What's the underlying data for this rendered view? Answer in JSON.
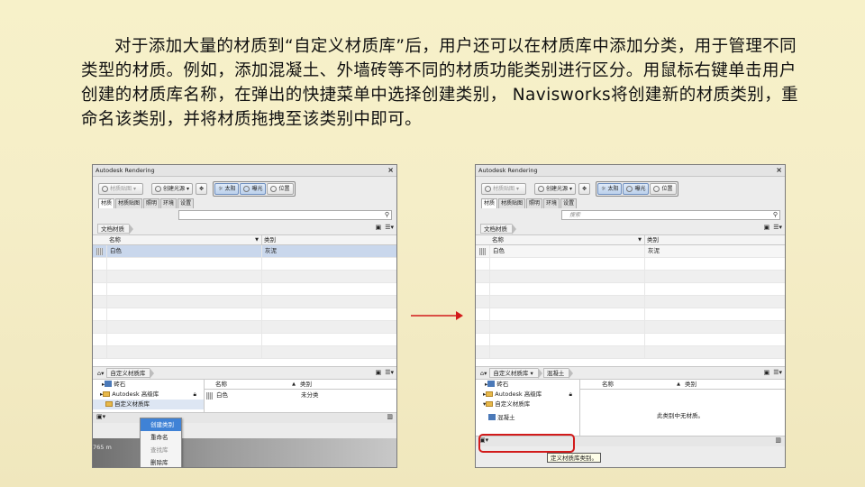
{
  "paragraph": "对于添加大量的材质到“自定义材质库”后，用户还可以在材质库中添加分类，用于管理不同类型的材质。例如，添加混凝土、外墙砖等不同的材质功能类别进行区分。用鼠标右键单击用户创建的材质库名称，在弹出的快捷菜单中选择创建类别， Navisworks将创建新的材质类别，重命名该类别，并将材质拖拽至该类别中即可。",
  "colors": {
    "arrow": "#d21b1b",
    "selection": "#c9d7ec",
    "menu_highlight": "#3f82d6"
  },
  "window1": {
    "title": "Autodesk Rendering",
    "toolbar": {
      "material_map": "材质贴图",
      "create_light": "创建光源",
      "sun": "太阳",
      "exposure": "曝光",
      "location": "位置"
    },
    "tabs": [
      "材质",
      "材质贴图",
      "照明",
      "环境",
      "设置"
    ],
    "crumb": "文档材质",
    "grid_header": {
      "name": "名称",
      "category": "类别"
    },
    "grid_rows": [
      {
        "name": "白色",
        "category": "灰泥"
      }
    ],
    "lib_crumb": "自定义材质库",
    "tree": [
      "砖石",
      "Autodesk 高级库",
      "自定义材质库"
    ],
    "lib_header": {
      "name": "名称",
      "category": "类别"
    },
    "lib_rows": [
      {
        "name": "白色",
        "category": "未分类"
      }
    ],
    "context_menu": [
      "创建类别",
      "重命名",
      "查找库",
      "删除库"
    ],
    "scale_text": "765 m"
  },
  "window2": {
    "title": "Autodesk Rendering",
    "toolbar": {
      "material_map": "材质贴图",
      "create_light": "创建光源",
      "sun": "太阳",
      "exposure": "曝光",
      "location": "位置"
    },
    "tabs": [
      "材质",
      "材质贴图",
      "照明",
      "环境",
      "设置"
    ],
    "search_placeholder": "搜索",
    "crumb": "文档材质",
    "grid_header": {
      "name": "名称",
      "category": "类别"
    },
    "grid_rows": [
      {
        "name": "白色",
        "category": "灰泥"
      }
    ],
    "lib_crumb": [
      "自定义材质库",
      "混凝土"
    ],
    "tree": [
      "砖石",
      "Autodesk 高级库",
      "自定义材质库",
      "混凝土"
    ],
    "lib_header": {
      "name": "名称",
      "category": "类别"
    },
    "empty_text": "此类别中无材质。",
    "tooltip": "定义材质库类别。"
  }
}
